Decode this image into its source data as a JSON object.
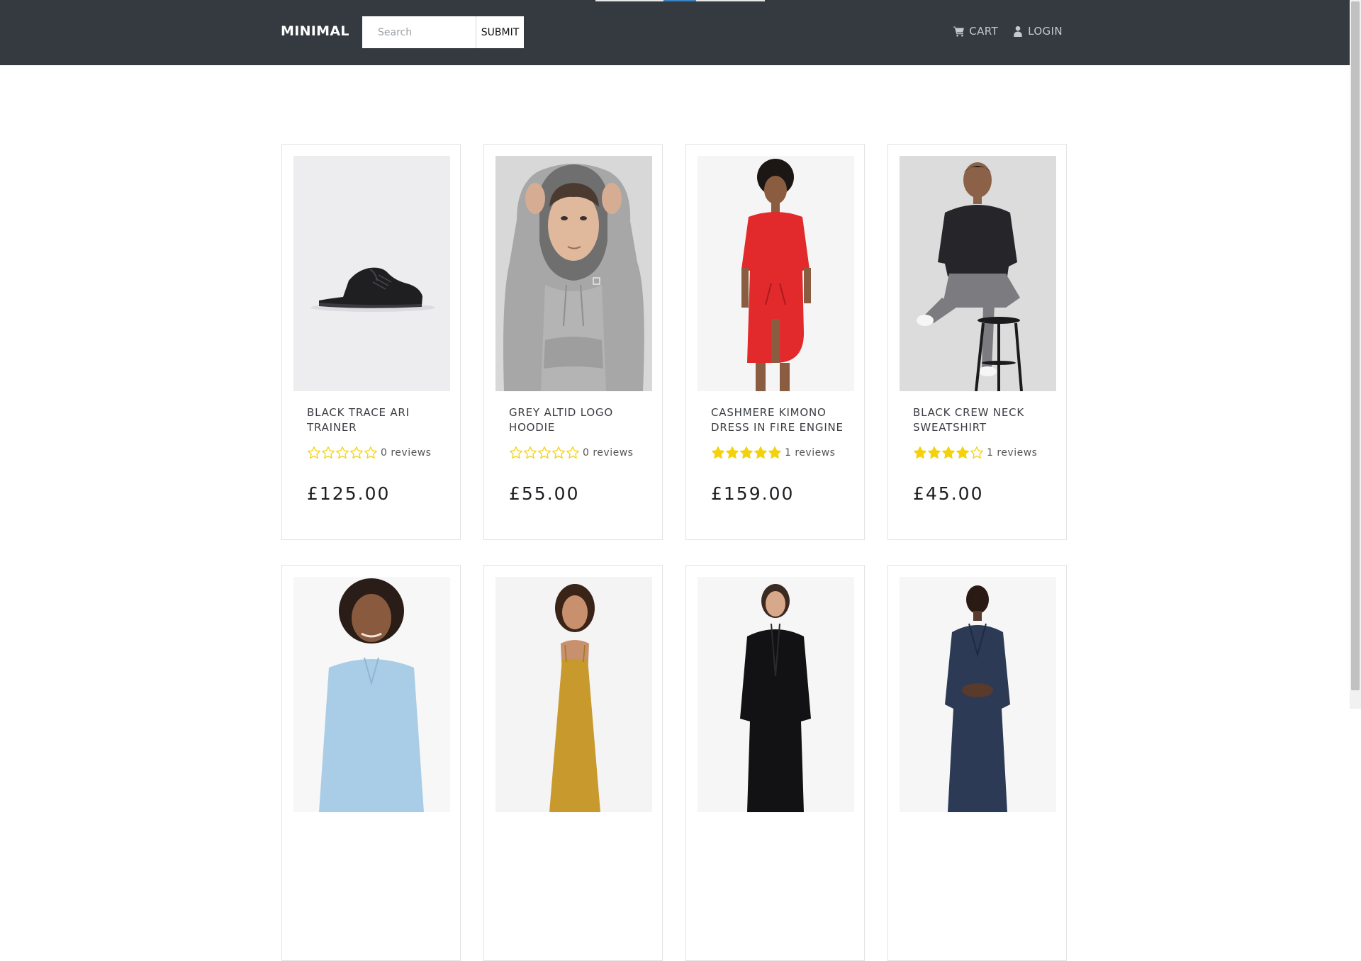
{
  "header": {
    "logo": "MINIMAL",
    "search_placeholder": "Search",
    "search_value": "",
    "submit_label": "SUBMIT",
    "cart_label": "CART",
    "login_label": "LOGIN",
    "cart_icon": "shopping-cart-icon",
    "login_icon": "user-icon"
  },
  "colors": {
    "header_bg": "#343a40",
    "star": "#f5d10a",
    "loader_segments": [
      "#e8e8e8",
      "#3d82c4",
      "#e8e8e8"
    ]
  },
  "products": [
    {
      "name": "BLACK TRACE ARI TRAINER",
      "rating": 0,
      "reviews": "0 reviews",
      "price": "£125.00",
      "image": "black-trainer"
    },
    {
      "name": "GREY ALTID LOGO HOODIE",
      "rating": 0,
      "reviews": "0 reviews",
      "price": "£55.00",
      "image": "grey-hoodie"
    },
    {
      "name": "CASHMERE KIMONO DRESS IN FIRE ENGINE",
      "rating": 5,
      "reviews": "1 reviews",
      "price": "£159.00",
      "image": "red-dress"
    },
    {
      "name": "BLACK CREW NECK SWEATSHIRT",
      "rating": 4,
      "reviews": "1 reviews",
      "price": "£45.00",
      "image": "black-sweatshirt"
    },
    {
      "name": "",
      "rating": null,
      "reviews": "",
      "price": "",
      "image": "light-blue-shirt"
    },
    {
      "name": "",
      "rating": null,
      "reviews": "",
      "price": "",
      "image": "mustard-slip-dress"
    },
    {
      "name": "",
      "rating": null,
      "reviews": "",
      "price": "",
      "image": "black-jumpsuit"
    },
    {
      "name": "",
      "rating": null,
      "reviews": "",
      "price": "",
      "image": "navy-dress"
    }
  ]
}
